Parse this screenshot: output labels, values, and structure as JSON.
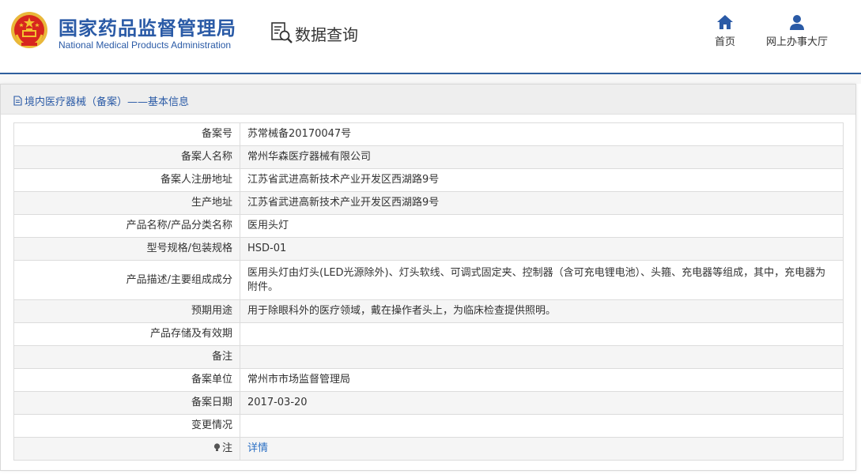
{
  "header": {
    "brand_cn": "国家药品监督管理局",
    "brand_en": "National Medical Products Administration",
    "query_label": "数据查询",
    "nav": [
      {
        "label": "首页",
        "icon": "home-icon"
      },
      {
        "label": "网上办事大厅",
        "icon": "user-icon"
      }
    ]
  },
  "panel": {
    "title": "境内医疗器械（备案）——基本信息"
  },
  "rows": [
    {
      "key": "备案号",
      "value": "苏常械备20170047号"
    },
    {
      "key": "备案人名称",
      "value": "常州华森医疗器械有限公司"
    },
    {
      "key": "备案人注册地址",
      "value": "江苏省武进高新技术产业开发区西湖路9号"
    },
    {
      "key": "生产地址",
      "value": "江苏省武进高新技术产业开发区西湖路9号"
    },
    {
      "key": "产品名称/产品分类名称",
      "value": "医用头灯"
    },
    {
      "key": "型号规格/包装规格",
      "value": "HSD-01"
    },
    {
      "key": "产品描述/主要组成成分",
      "value": "医用头灯由灯头(LED光源除外)、灯头软线、可调式固定夹、控制器（含可充电锂电池）、头箍、充电器等组成，其中，充电器为附件。"
    },
    {
      "key": "预期用途",
      "value": "用于除眼科外的医疗领域，戴在操作者头上，为临床检查提供照明。"
    },
    {
      "key": "产品存储及有效期",
      "value": ""
    },
    {
      "key": "备注",
      "value": ""
    },
    {
      "key": "备案单位",
      "value": "常州市市场监督管理局"
    },
    {
      "key": "备案日期",
      "value": "2017-03-20"
    },
    {
      "key": "变更情况",
      "value": ""
    },
    {
      "key": "注",
      "value": "详情"
    }
  ],
  "colors": {
    "brand_blue": "#2a5aa6",
    "link_blue": "#2a6fc4",
    "emblem_red": "#d7261e",
    "emblem_gold": "#f2c230"
  }
}
